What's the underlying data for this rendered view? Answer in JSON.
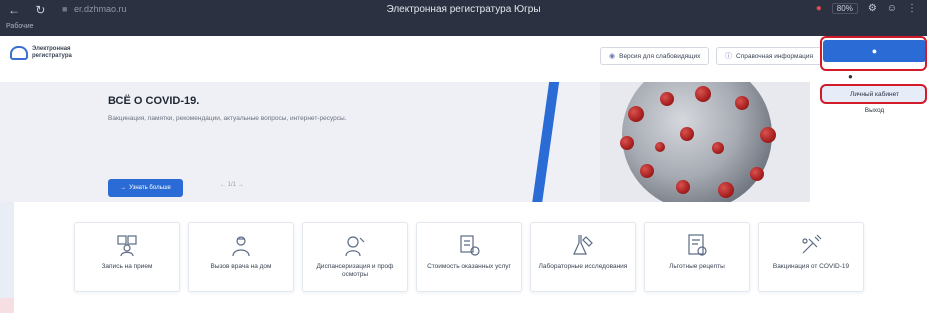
{
  "browser": {
    "url": "er.dzhmao.ru",
    "page_title": "Электронная регистратура Югры",
    "bookmarks_label": "Рабочие",
    "zoom": "80%"
  },
  "header": {
    "logo_line1": "Электронная",
    "logo_line2": "регистратура",
    "accessibility_button": "Версия для слабовидящих",
    "info_button": "Справочная информация"
  },
  "user_menu": {
    "items": [
      "Личный кабинет",
      "Выход"
    ]
  },
  "hero": {
    "title": "ВСЁ О COVID-19.",
    "subtitle": "Вакцинация, памятки, рекомендации, актуальные вопросы, интернет-ресурсы.",
    "button_label": "Узнать больше",
    "pager": "1/1"
  },
  "services": [
    {
      "label": "Запись на прием",
      "icon": "doctor-appointment-icon"
    },
    {
      "label": "Вызов врача на дом",
      "icon": "doctor-home-icon"
    },
    {
      "label": "Диспансеризация и проф осмотры",
      "icon": "checkup-icon"
    },
    {
      "label": "Стоимость оказанных услуг",
      "icon": "cost-icon"
    },
    {
      "label": "Лабораторные исследования",
      "icon": "lab-icon"
    },
    {
      "label": "Льготные рецепты",
      "icon": "prescription-icon"
    },
    {
      "label": "Вакцинация от COVID-19",
      "icon": "vaccine-icon"
    }
  ],
  "colors": {
    "accent": "#2a6bd6",
    "highlight": "#d11a2a"
  }
}
